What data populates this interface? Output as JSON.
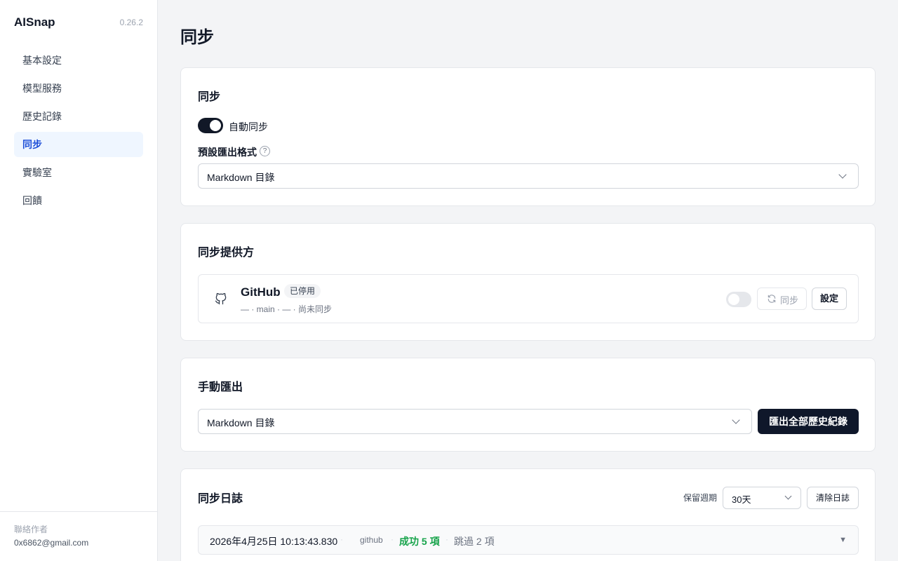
{
  "app": {
    "name": "AISnap",
    "version": "0.26.2"
  },
  "sidebar": {
    "items": [
      {
        "label": "基本設定"
      },
      {
        "label": "模型服務"
      },
      {
        "label": "歷史記錄"
      },
      {
        "label": "同步"
      },
      {
        "label": "實驗室"
      },
      {
        "label": "回饋"
      }
    ],
    "active_index": 3,
    "footer": {
      "contact_label": "聯絡作者",
      "email": "0x6862@gmail.com"
    }
  },
  "page": {
    "title": "同步"
  },
  "sync_card": {
    "title": "同步",
    "auto_sync_label": "自動同步",
    "auto_sync_on": true,
    "default_format_label": "預設匯出格式",
    "help_glyph": "?",
    "default_format_value": "Markdown 目錄"
  },
  "providers_card": {
    "title": "同步提供方",
    "provider": {
      "name": "GitHub",
      "status_badge": "已停用",
      "meta": "— · main · — · 尚未同步",
      "enabled": false,
      "sync_label": "同步",
      "settings_label": "設定"
    }
  },
  "manual_export_card": {
    "title": "手動匯出",
    "format_value": "Markdown 目錄",
    "export_label": "匯出全部歷史紀錄"
  },
  "log_card": {
    "title": "同步日誌",
    "retention_label": "保留週期",
    "retention_value": "30天",
    "clear_label": "清除日誌",
    "entries": [
      {
        "timestamp": "2026年4月25日 10:13:43.830",
        "separator": "·",
        "provider": "github",
        "success": "成功 5 項",
        "skipped": "跳過 2 項",
        "caret": "▼"
      }
    ]
  },
  "colors": {
    "accent": "#1d4ed8",
    "active_bg": "#eff6ff",
    "dark_button": "#0f172a",
    "success": "#16a34a"
  }
}
